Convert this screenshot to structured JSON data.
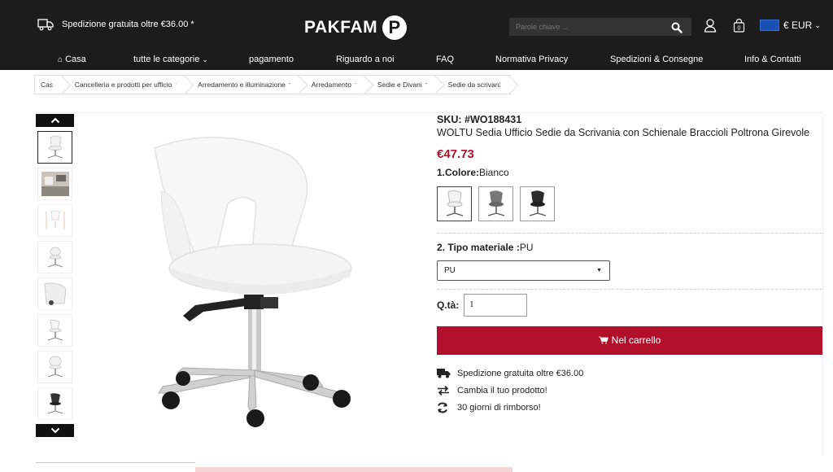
{
  "header": {
    "shipping_note": "Spedizione gratuita oltre €36.00 *",
    "logo_text": "PAKFAM",
    "logo_letter": "P",
    "search_placeholder": "Parole chiave ...",
    "currency": "€ EUR",
    "cart_count": "0"
  },
  "nav": {
    "items": [
      "Casa",
      "tutte le categorie",
      "pagamento",
      "Riguardo a noi",
      "FAQ",
      "Normativa Privacy",
      "Spedizioni & Consegne",
      "Info & Contatti"
    ]
  },
  "breadcrumb": [
    "Casa",
    "Cancelleria e prodotti per ufficio",
    "Arredamento e illuminazione",
    "Arredamento",
    "Sedie e Divani",
    "Sedie da scrivania"
  ],
  "product": {
    "sku": "SKU: #WO188431",
    "title": "WOLTU Sedia Ufficio Sedie da Scrivania con Schienale Braccioli Poltrona Girevole",
    "price": "€47.73",
    "color_label": "1.Colore:",
    "color_value": "Bianco",
    "material_label": "2. Tipo materiale :",
    "material_value": "PU",
    "material_selected": "PU",
    "qty_label": "Q.tà:",
    "qty_value": "1",
    "cart_button": "Nel carrello"
  },
  "features": [
    "Spedizione gratuita oltre €36.00",
    "Cambia il tuo prodotto!",
    "30 giorni di rimborso!"
  ],
  "colors": {
    "accent": "#b2102a",
    "header_bg": "#1c1c1c"
  }
}
